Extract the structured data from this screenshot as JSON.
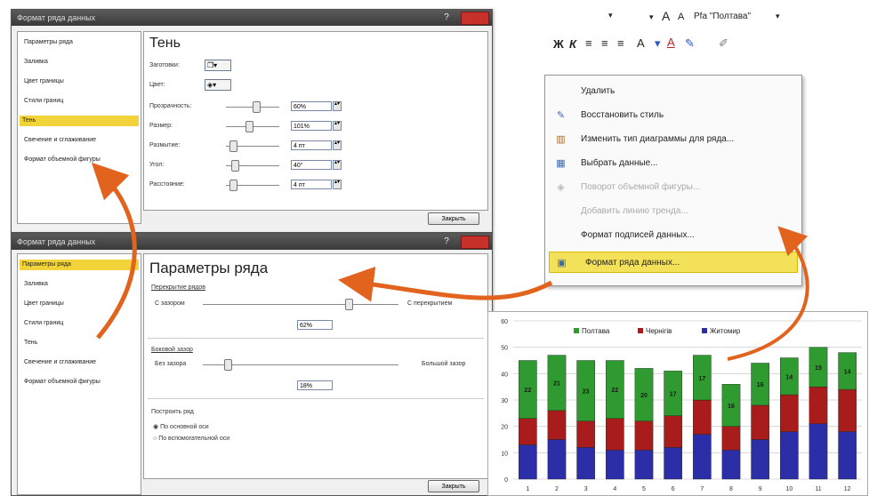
{
  "dialog_top": {
    "title": "Формат ряда данных",
    "help": "?",
    "nav": [
      "Параметры ряда",
      "Заливка",
      "Цвет границы",
      "Стили границ",
      "Тень",
      "Свечение и сглаживание",
      "Формат объемной фигуры"
    ],
    "selected_nav": "Тень",
    "heading": "Тень",
    "preset_label": "Заготовки:",
    "color_label": "Цвет:",
    "rows": [
      {
        "label": "Прозрачность:",
        "value": "60%"
      },
      {
        "label": "Размер:",
        "value": "101%"
      },
      {
        "label": "Размытие:",
        "value": "4 пт"
      },
      {
        "label": "Угол:",
        "value": "40°"
      },
      {
        "label": "Расстояние:",
        "value": "4 пт"
      }
    ],
    "close_label": "Закрыть"
  },
  "dialog_bottom": {
    "title": "Формат ряда данных",
    "nav": [
      "Параметры ряда",
      "Заливка",
      "Цвет границы",
      "Стили границ",
      "Тень",
      "Свечение и сглаживание",
      "Формат объемной фигуры"
    ],
    "selected_nav": "Параметры ряда",
    "heading": "Параметры ряда",
    "overlap_label": "Перекрытие рядов",
    "overlap_left": "С зазором",
    "overlap_right": "С перекрытием",
    "overlap_value": "62%",
    "gap_label": "Боковой зазор",
    "gap_left": "Без зазора",
    "gap_right": "Большой зазор",
    "gap_value": "18%",
    "plot_on_label": "Построить ряд",
    "radio_primary": "По основной оси",
    "radio_secondary": "По вспомогательной оси",
    "close_label": "Закрыть"
  },
  "toolbar": {
    "font_name": "Pfa \"Полтава\"",
    "bold": "Ж",
    "italic": "К",
    "grow_font": "A",
    "shrink_font": "A"
  },
  "context_menu": {
    "items": [
      {
        "label": "Удалить",
        "icon": "delete-icon",
        "disabled": false
      },
      {
        "label": "Восстановить стиль",
        "icon": "reset-style-icon",
        "disabled": false
      },
      {
        "label": "Изменить тип диаграммы для ряда...",
        "icon": "chart-type-icon",
        "disabled": false
      },
      {
        "label": "Выбрать данные...",
        "icon": "select-data-icon",
        "disabled": false
      },
      {
        "label": "Поворот объемной фигуры...",
        "icon": "rotate-3d-icon",
        "disabled": true
      },
      {
        "label": "Добавить линию тренда...",
        "icon": "",
        "disabled": true
      },
      {
        "label": "Формат подписей данных...",
        "icon": "",
        "disabled": false
      },
      {
        "label": "Формат ряда данных...",
        "icon": "format-series-icon",
        "disabled": false,
        "selected": true
      }
    ]
  },
  "chart_data": {
    "type": "bar",
    "stacked": true,
    "categories": [
      "1",
      "2",
      "3",
      "4",
      "5",
      "6",
      "7",
      "8",
      "9",
      "10",
      "11",
      "12"
    ],
    "series": [
      {
        "name": "Житомир",
        "color": "#2c2ea8",
        "values": [
          13,
          15,
          12,
          11,
          11,
          12,
          17,
          11,
          15,
          18,
          21,
          18
        ]
      },
      {
        "name": "Чернігів",
        "color": "#a81c1c",
        "values": [
          10,
          11,
          10,
          12,
          11,
          12,
          13,
          9,
          13,
          14,
          14,
          16
        ]
      },
      {
        "name": "Полтава",
        "color": "#2f9a2f",
        "values": [
          22,
          21,
          23,
          22,
          20,
          17,
          17,
          16,
          16,
          14,
          15,
          14
        ]
      }
    ],
    "ylim": [
      0,
      60
    ],
    "yticks": [
      0,
      10,
      20,
      30,
      40,
      50,
      60
    ],
    "legend_position": "top"
  }
}
